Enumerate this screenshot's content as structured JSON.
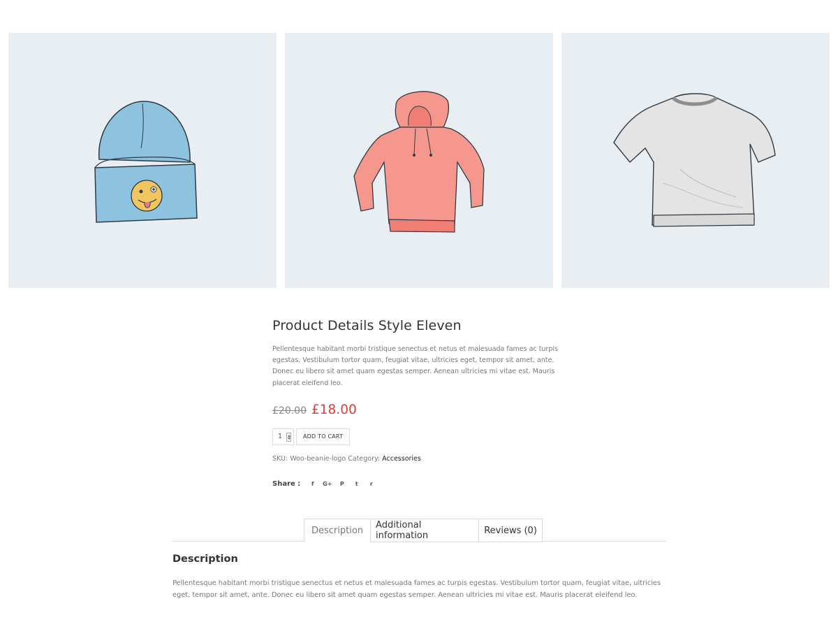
{
  "gallery": {
    "images": [
      {
        "name": "beanie-image",
        "icon": "beanie-with-emoji-icon",
        "color": "#8ec3e0"
      },
      {
        "name": "hoodie-image",
        "icon": "hoodie-icon",
        "color": "#f5978c"
      },
      {
        "name": "tshirt-image",
        "icon": "tshirt-icon",
        "color": "#e4e4e4"
      }
    ],
    "background": "#e9eef3"
  },
  "product": {
    "title": "Product Details Style Eleven",
    "short_description": "Pellentesque habitant morbi tristique senectus et netus et malesuada fames ac turpis egestas. Vestibulum tortor quam, feugiat vitae, ultricies eget, tempor sit amet, ante. Donec eu libero sit amet quam egestas semper. Aenean ultricies mi vitae est. Mauris placerat eleifend leo.",
    "old_price": "£20.00",
    "new_price": "£18.00",
    "sale_color": "#e43b3b",
    "quantity": "1",
    "add_to_cart_label": "ADD TO CART",
    "sku_label": "SKU:",
    "sku_value": "Woo-beanie-logo",
    "category_label": "Category:",
    "category_value": "Accessories"
  },
  "share": {
    "label": "Share :",
    "icons": [
      {
        "name": "facebook-icon",
        "glyph": "f"
      },
      {
        "name": "google-plus-icon",
        "glyph": "G+"
      },
      {
        "name": "pinterest-icon",
        "glyph": "P"
      },
      {
        "name": "twitter-icon",
        "glyph": "t"
      },
      {
        "name": "reddit-icon",
        "glyph": "r"
      }
    ]
  },
  "tabs": {
    "items": [
      {
        "label": "Description",
        "active": true
      },
      {
        "label": "Additional information",
        "active": false
      },
      {
        "label": "Reviews (0)",
        "active": false
      }
    ],
    "panel_title": "Description",
    "panel_text": "Pellentesque habitant morbi tristique senectus et netus et malesuada fames ac turpis egestas. Vestibulum tortor quam, feugiat vitae, ultricies eget, tempor sit amet, ante. Donec eu libero sit amet quam egestas semper. Aenean ultricies mi vitae est. Mauris placerat eleifend leo."
  }
}
